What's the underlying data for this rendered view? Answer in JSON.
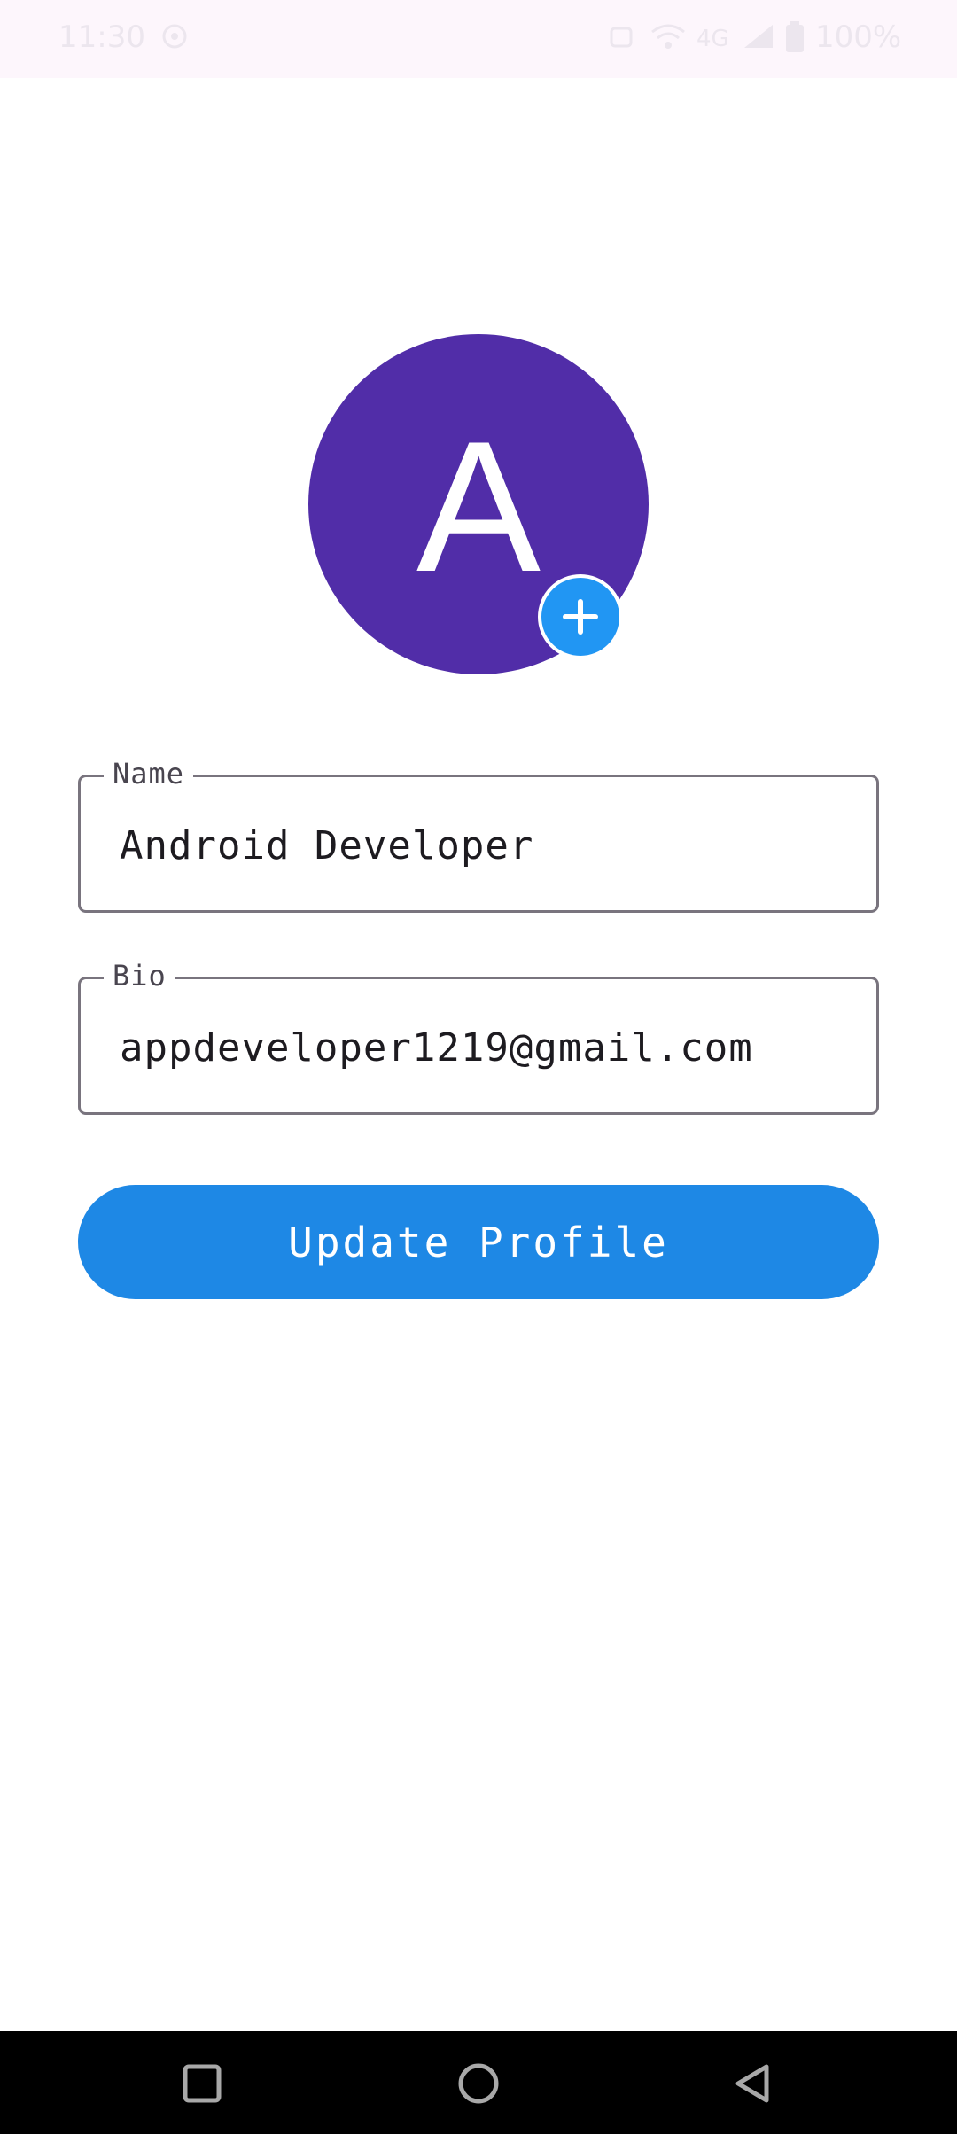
{
  "status_bar": {
    "time": "11:30",
    "network": "4G",
    "battery": "100%"
  },
  "avatar": {
    "letter": "A",
    "color": "#512da8"
  },
  "form": {
    "name": {
      "label": "Name",
      "value": "Android Developer"
    },
    "bio": {
      "label": "Bio",
      "value": "appdeveloper1219@gmail.com"
    }
  },
  "actions": {
    "update_label": "Update Profile",
    "accent_color": "#1e88e5"
  },
  "nav_bar": {
    "icons": [
      "recents-icon",
      "home-icon",
      "back-icon"
    ]
  }
}
